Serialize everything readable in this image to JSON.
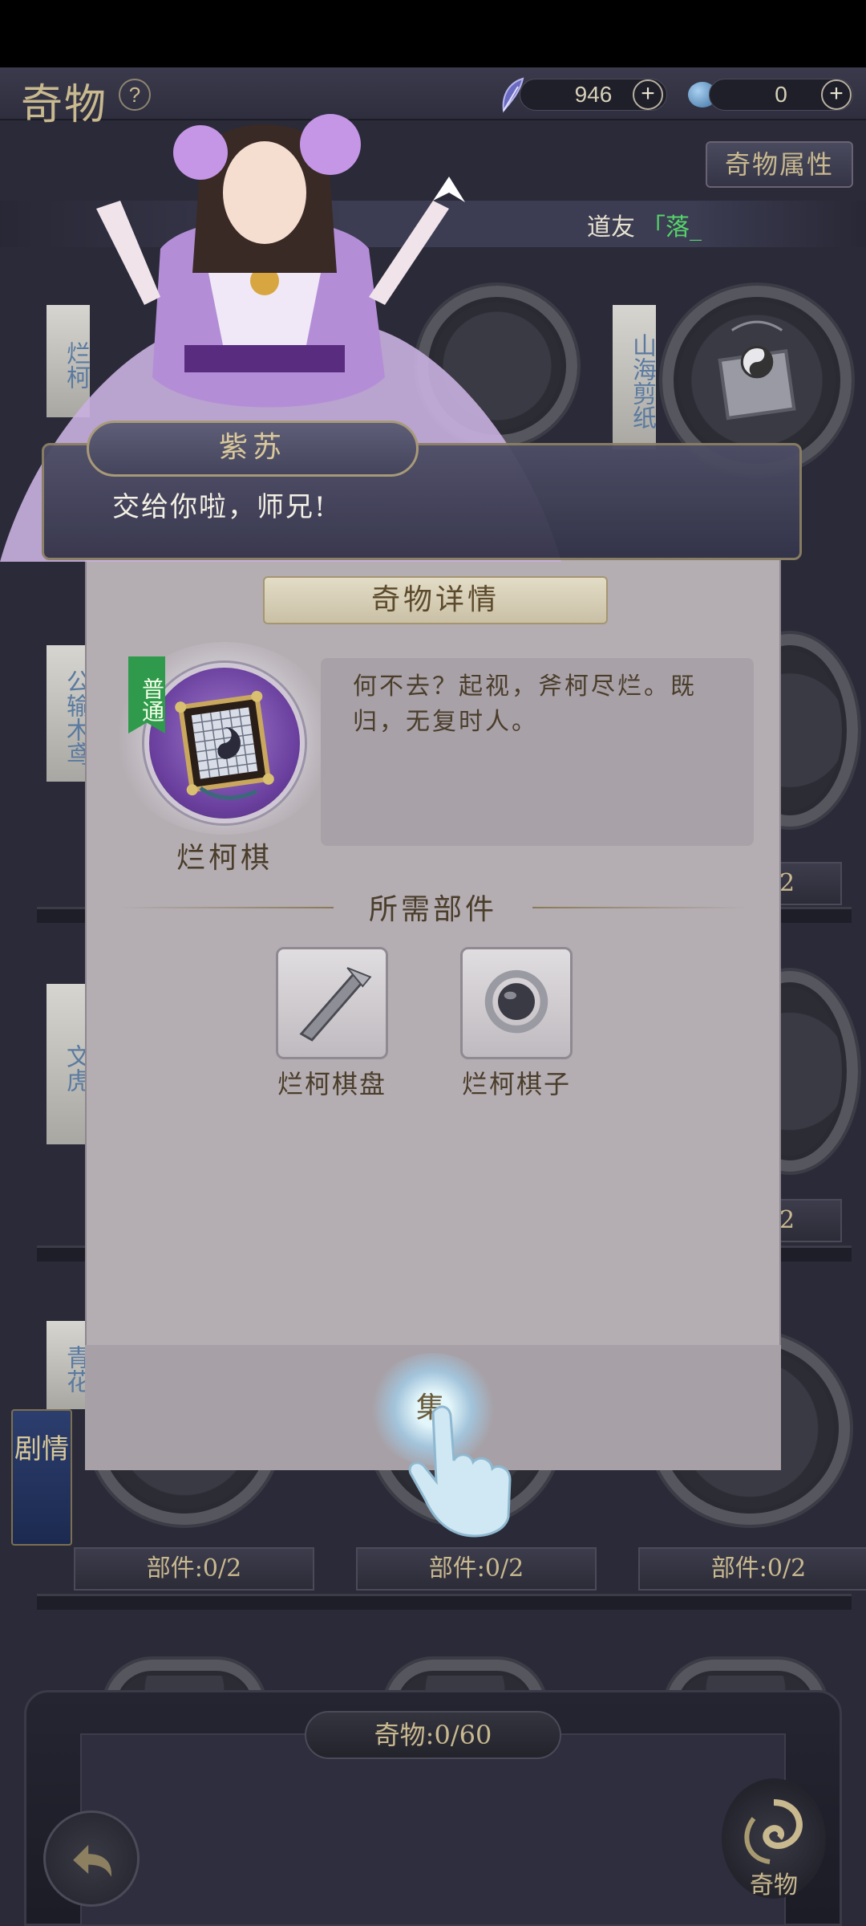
{
  "header": {
    "title": "奇物",
    "help": "?",
    "currency1": {
      "value": "946",
      "icon": "feather-icon"
    },
    "currency2": {
      "value": "0",
      "icon": "gem-icon"
    },
    "plus": "+",
    "attributes_button": "奇物属性"
  },
  "ticker": {
    "prefix": "道友",
    "name": "「落_"
  },
  "grid": {
    "labels": [
      "烂柯",
      "山海剪纸",
      "公输木鸢",
      "文虎",
      "青花"
    ],
    "parts_count": "部件:0/2",
    "partial_counts": [
      "2",
      "2"
    ]
  },
  "dialog": {
    "speaker": "紫苏",
    "text": "交给你啦，师兄!"
  },
  "detail": {
    "title": "奇物详情",
    "rarity": "普通",
    "item_name": "烂柯棋",
    "description": "何不去？起视，斧柯尽烂。既归，无复时人。",
    "parts_title": "所需部件",
    "parts": [
      {
        "label": "烂柯棋盘",
        "icon": "broken-axe-handle-icon"
      },
      {
        "label": "烂柯棋子",
        "icon": "go-stone-icon"
      }
    ],
    "collect_button": "集"
  },
  "side": {
    "story_tab": "剧情"
  },
  "footer": {
    "total": "奇物:0/60",
    "nav_qiwu": "奇物"
  },
  "colors": {
    "accent_gold": "#c9b98f",
    "panel_bg": "#b4adb2",
    "rarity_green": "#2f9a4c",
    "ticker_name": "#55d46b"
  }
}
